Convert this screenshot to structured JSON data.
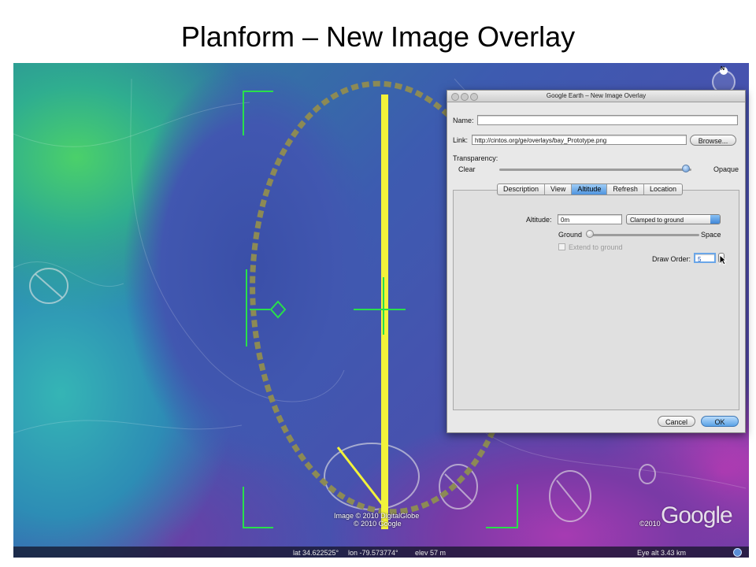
{
  "slide": {
    "title": "Planform – New Image Overlay"
  },
  "map": {
    "copyright_line1": "Image © 2010 DigitalGlobe",
    "copyright_line2": "© 2010 Google",
    "logo_year": "©2010",
    "logo_text": "Google",
    "compass_label": "N",
    "status": {
      "lat": "lat  34.622525°",
      "lon": "lon  -79.573774°",
      "elev": "elev  57 m",
      "eye_alt": "Eye alt    3.43 km"
    }
  },
  "dialog": {
    "title": "Google Earth – New Image Overlay",
    "name_label": "Name:",
    "name_value": "",
    "link_label": "Link:",
    "link_value": "http://cintos.org/ge/overlays/bay_Prototype.png",
    "browse_label": "Browse...",
    "transparency_label": "Transparency:",
    "transparency_min": "Clear",
    "transparency_max": "Opaque",
    "transparency_level": 0.97,
    "tabs": [
      "Description",
      "View",
      "Altitude",
      "Refresh",
      "Location"
    ],
    "selected_tab": "Altitude",
    "altitude_label": "Altitude:",
    "altitude_value": "0m",
    "altitude_mode": "Clamped to ground",
    "slider_min": "Ground",
    "slider_max": "Space",
    "altitude_level": 0.0,
    "extend_label": "Extend to ground",
    "draw_order_label": "Draw Order:",
    "draw_order_value": "5",
    "cancel_label": "Cancel",
    "ok_label": "OK"
  },
  "colors": {
    "accent": "#4e94de",
    "overlay_line": "#f2f23a",
    "overlay_ellipse": "#8c8a55",
    "handle_green": "#29e04a"
  }
}
